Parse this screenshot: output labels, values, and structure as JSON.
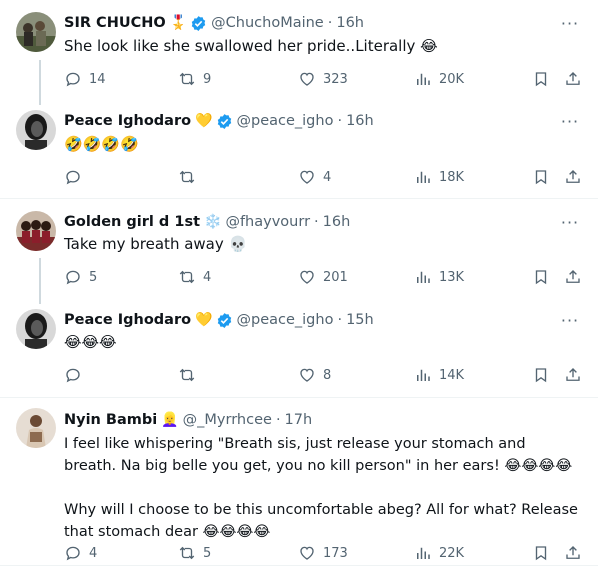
{
  "colors": {
    "verified": "#1d9bf0",
    "text_secondary": "#536471",
    "divider": "#eff3f4",
    "thread_line": "#cfd9de"
  },
  "tweets": [
    {
      "name": "SIR CHUCHO",
      "badge": "🎖️",
      "verified": true,
      "handle": "@ChuchoMaine",
      "time": "16h",
      "text": "She look like she swallowed her pride..Literally 😂",
      "replies": "14",
      "retweets": "9",
      "likes": "323",
      "views": "20K"
    },
    {
      "name": "Peace Ighodaro",
      "badge": "💛",
      "verified": true,
      "handle": "@peace_igho",
      "time": "16h",
      "text": "🤣🤣🤣🤣",
      "replies": "",
      "retweets": "",
      "likes": "4",
      "views": "18K"
    },
    {
      "name": "Golden girl d 1st",
      "badge": "❄️",
      "verified": false,
      "handle": "@fhayvourr",
      "time": "16h",
      "text": "Take my breath away 💀",
      "replies": "5",
      "retweets": "4",
      "likes": "201",
      "views": "13K"
    },
    {
      "name": "Peace Ighodaro",
      "badge": "💛",
      "verified": true,
      "handle": "@peace_igho",
      "time": "15h",
      "text": "😂😂😂",
      "replies": "",
      "retweets": "",
      "likes": "8",
      "views": "14K"
    },
    {
      "name": "Nyin Bambi",
      "badge": "👱‍♀️",
      "verified": false,
      "handle": "@_Myrrhcee",
      "time": "17h",
      "text": "I feel like whispering \"Breath sis, just release your stomach and breath. Na big belle you get, you no kill person\" in her ears! 😂😂😂😂\n\nWhy will I choose to be this uncomfortable abeg? All for what? Release that stomach dear 😂😂😂😂",
      "replies": "4",
      "retweets": "5",
      "likes": "173",
      "views": "22K"
    }
  ],
  "more_glyph": "···"
}
